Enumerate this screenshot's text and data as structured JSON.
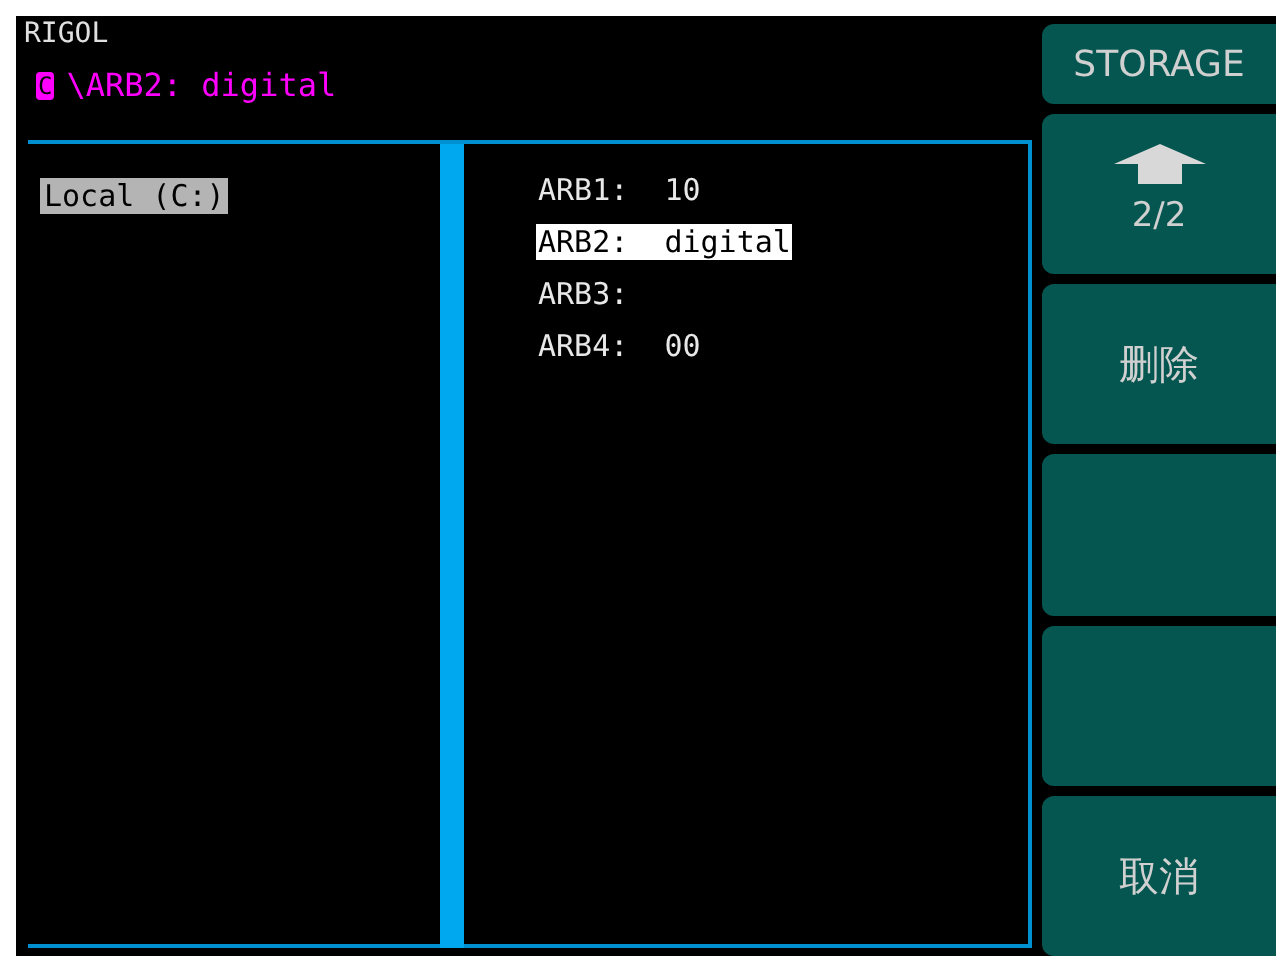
{
  "title": "RIGOL",
  "path": {
    "drive": "C",
    "text": "\\ARB2: digital"
  },
  "drives": [
    {
      "label": "Local (C:)",
      "selected": true
    }
  ],
  "files": [
    {
      "label": "ARB1:  10",
      "selected": false
    },
    {
      "label": "ARB2:  digital",
      "selected": true
    },
    {
      "label": "ARB3:",
      "selected": false
    },
    {
      "label": "ARB4:  00",
      "selected": false
    }
  ],
  "menu": {
    "title": "STORAGE",
    "buttons": [
      {
        "kind": "page",
        "label": "2/2"
      },
      {
        "kind": "text",
        "label": "删除"
      },
      {
        "kind": "empty"
      },
      {
        "kind": "empty"
      },
      {
        "kind": "text",
        "label": "取消"
      }
    ]
  }
}
